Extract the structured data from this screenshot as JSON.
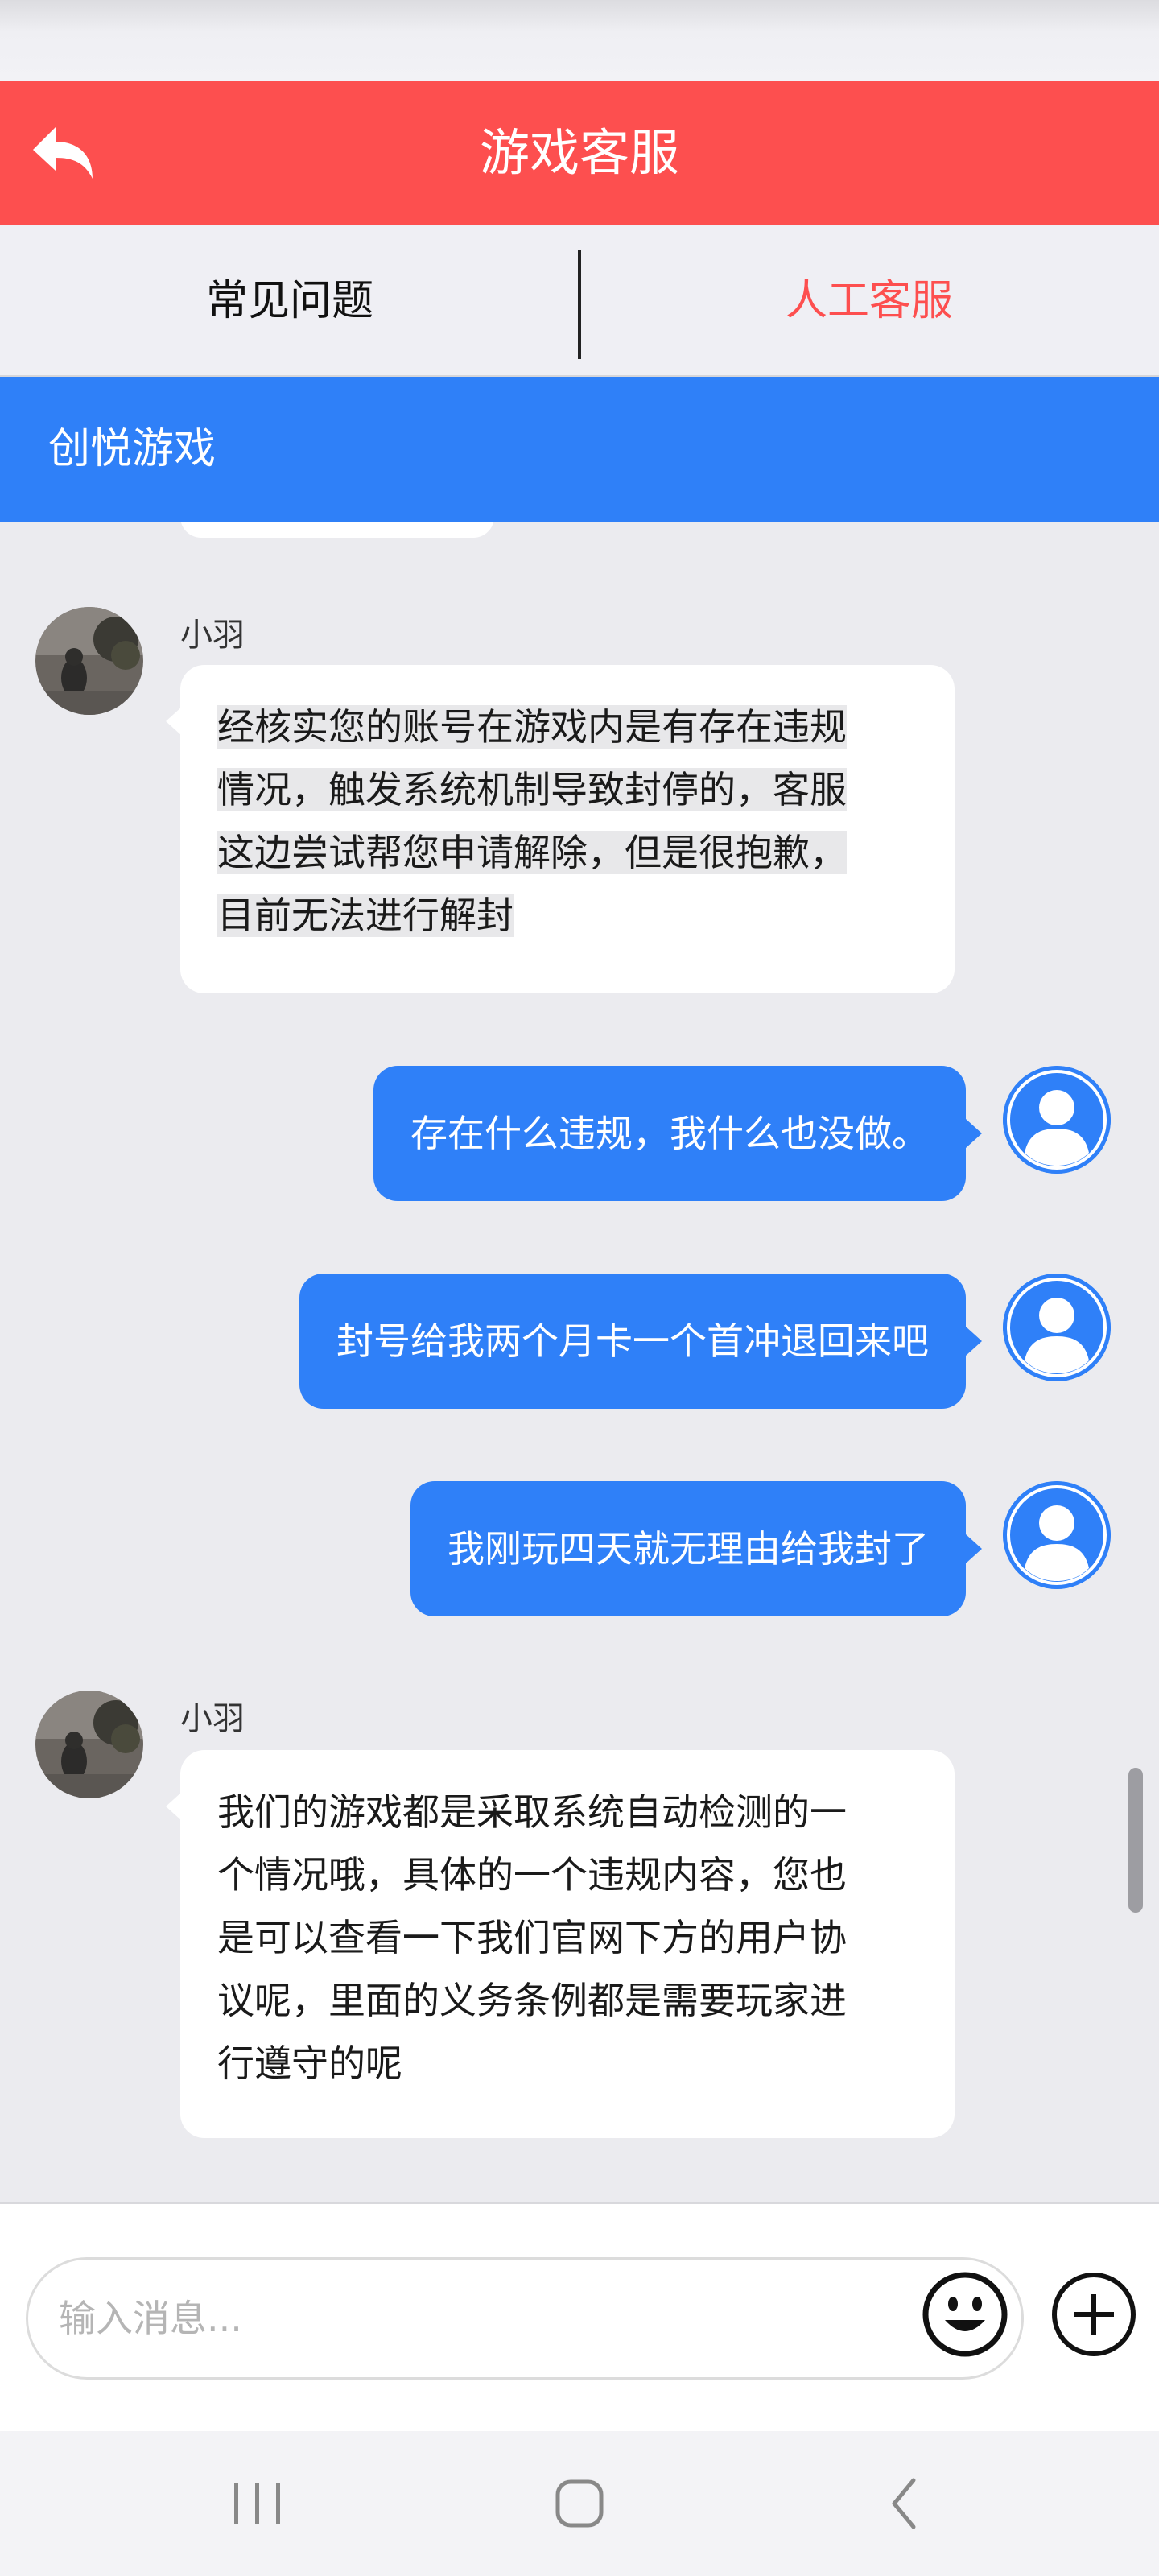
{
  "header": {
    "title": "游戏客服",
    "back_icon": "back-arrow-icon"
  },
  "tabs": [
    {
      "label": "常见问题",
      "active": false,
      "color": "#111111"
    },
    {
      "label": "人工客服",
      "active": true,
      "color": "#fd4f4f"
    }
  ],
  "company": {
    "name": "创悦游戏"
  },
  "colors": {
    "header": "#fd4f4f",
    "accent_blue": "#2f80f8",
    "active_tab": "#fd4f4f"
  },
  "messages": [
    {
      "from": "agent",
      "name": "小羽",
      "lines": [
        "经核实您的账号在游戏内是有存在违规",
        "情况，触发系统机制导致封停的，客服",
        "这边尝试帮您申请解除，但是很抱歉，",
        "目前无法进行解封"
      ],
      "highlighted": true
    },
    {
      "from": "user",
      "text": "存在什么违规，我什么也没做。"
    },
    {
      "from": "user",
      "text": "封号给我两个月卡一个首冲退回来吧"
    },
    {
      "from": "user",
      "text": "我刚玩四天就无理由给我封了"
    },
    {
      "from": "agent",
      "name": "小羽",
      "lines": [
        "我们的游戏都是采取系统自动检测的一",
        "个情况哦，具体的一个违规内容，您也",
        "是可以查看一下我们官网下方的用户协",
        "议呢，里面的义务条例都是需要玩家进",
        "行遵守的呢"
      ],
      "highlighted": false
    }
  ],
  "input": {
    "placeholder": "输入消息...",
    "value": "",
    "emoji_icon": "emoji-icon",
    "plus_icon": "plus-circle-icon"
  },
  "navbar": {
    "recent_icon": "recent-apps-icon",
    "home_icon": "home-icon",
    "back_icon": "back-chevron-icon"
  }
}
